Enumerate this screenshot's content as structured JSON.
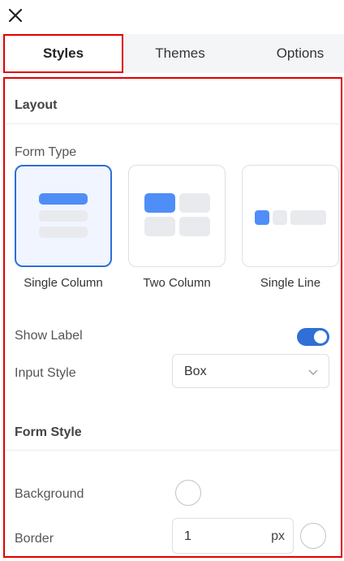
{
  "window": {
    "close_icon": "close-icon"
  },
  "tabs": [
    {
      "label": "Styles",
      "active": true
    },
    {
      "label": "Themes",
      "active": false
    },
    {
      "label": "Options",
      "active": false
    }
  ],
  "layout": {
    "title": "Layout",
    "form_type": {
      "label": "Form Type",
      "options": [
        {
          "label": "Single Column",
          "selected": true
        },
        {
          "label": "Two Column",
          "selected": false
        },
        {
          "label": "Single Line",
          "selected": false
        }
      ]
    },
    "show_label": {
      "label": "Show Label",
      "enabled": true
    },
    "input_style": {
      "label": "Input Style",
      "value": "Box"
    }
  },
  "form_style": {
    "title": "Form Style",
    "background": {
      "label": "Background"
    },
    "border": {
      "label": "Border",
      "value": "1",
      "unit": "px"
    }
  },
  "colors": {
    "accent": "#2f6fd6",
    "preview_primary": "#4f8ef7",
    "preview_muted": "#e9eaee",
    "highlight_outline": "#e00000"
  }
}
